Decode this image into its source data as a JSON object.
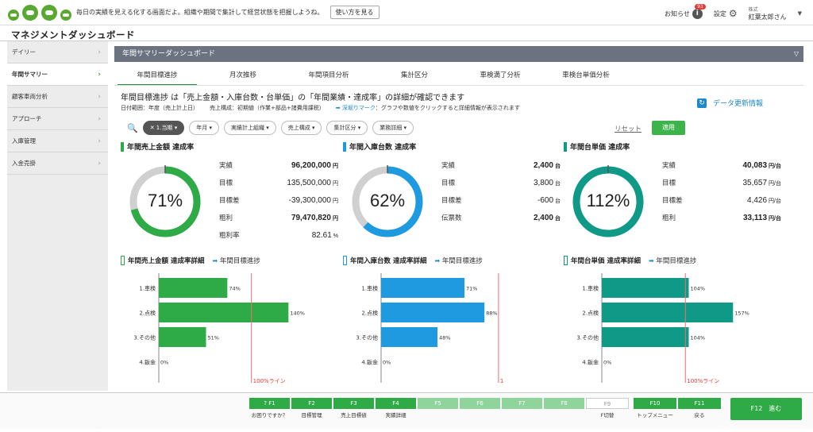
{
  "topbar": {
    "tagline": "毎日の実績を見える化する画面だよ。組織や期間で集計して経営状態を把握しようね。",
    "howto_label": "使い方を見る",
    "notice_label": "お知らせ",
    "notice_count": "93",
    "settings_label": "設定",
    "user_company": "株式",
    "user_name": "紅葉太郎さん"
  },
  "page_title": "マネジメントダッシュボード",
  "sidebar": {
    "items": [
      {
        "label": "デイリー"
      },
      {
        "label": "年間サマリー"
      },
      {
        "label": "顧客車両分析"
      },
      {
        "label": "アプローチ"
      },
      {
        "label": "入庫管理"
      },
      {
        "label": "入金売掛"
      }
    ]
  },
  "panel": {
    "title": "年間サマリーダッシュボード"
  },
  "tabs": [
    "年間目標進捗",
    "月次推移",
    "年間項目分析",
    "集計区分",
    "車検満了分析",
    "車検台単価分析"
  ],
  "summary": {
    "headline": "年間目標進捗 は「売上金額・入庫台数・台単価」の「年間業績・達成率」の詳細が確認できます",
    "date_range": "日付範囲：年度（売上計上日）",
    "sales_config": "売上構成：初期値（作業+部品+諸費用課税）",
    "drill_mark": "➡ 深堀りマーク",
    "drill_desc": "：グラフや数値をクリックすると詳細情報が表示されます",
    "refresh_label": "データ更新情報"
  },
  "filters": {
    "chips": [
      "✕ 1.当期",
      "年月",
      "実績計上組織",
      "売上構成",
      "集計区分",
      "業務詳細"
    ],
    "reset_label": "リセット",
    "apply_label": "適用"
  },
  "kpis": [
    {
      "title": "年間売上金額 達成率",
      "pct": "71%",
      "pct_value": 0.71,
      "color": "#2eaa46",
      "rows": [
        {
          "label": "実績",
          "value": "96,200,000",
          "unit": "円",
          "bold": true
        },
        {
          "label": "目標",
          "value": "135,500,000",
          "unit": "円"
        },
        {
          "label": "目標差",
          "value": "-39,300,000",
          "unit": "円"
        },
        {
          "label": "粗利",
          "value": "79,470,820",
          "unit": "円",
          "bold": true
        },
        {
          "label": "粗利率",
          "value": "82.61",
          "unit": "%"
        }
      ]
    },
    {
      "title": "年間入庫台数 達成率",
      "pct": "62%",
      "pct_value": 0.62,
      "color": "#1e9ae0",
      "rows": [
        {
          "label": "実績",
          "value": "2,400",
          "unit": "台",
          "bold": true
        },
        {
          "label": "目標",
          "value": "3,800",
          "unit": "台"
        },
        {
          "label": "目標差",
          "value": "-600",
          "unit": "台"
        },
        {
          "label": "伝票数",
          "value": "2,400",
          "unit": "台",
          "bold": true
        }
      ]
    },
    {
      "title": "年間台単価 達成率",
      "pct": "112%",
      "pct_value": 1.12,
      "color": "#0e9a86",
      "rows": [
        {
          "label": "実績",
          "value": "40,083",
          "unit": "円/台",
          "bold": true
        },
        {
          "label": "目標",
          "value": "35,657",
          "unit": "円/台"
        },
        {
          "label": "目標差",
          "value": "4,426",
          "unit": "円/台"
        },
        {
          "label": "粗利",
          "value": "33,113",
          "unit": "円/台",
          "bold": true
        }
      ]
    }
  ],
  "chart_data": [
    {
      "type": "bar",
      "title": "年間売上金額 達成率詳細",
      "link": "年間目標進捗",
      "categories": [
        "1.車検",
        "2.点検",
        "3.その他",
        "4.鈑金"
      ],
      "values": [
        74,
        140,
        51,
        0
      ],
      "value_labels": [
        "74%",
        "140%",
        "51%",
        "0%"
      ],
      "reference_line": 100,
      "reference_label": "100%ライン",
      "color": "#2eaa46"
    },
    {
      "type": "bar",
      "title": "年間入庫台数 達成率詳細",
      "link": "年間目標進捗",
      "categories": [
        "1.車検",
        "2.点検",
        "3.その他",
        "4.鈑金"
      ],
      "values": [
        71,
        88,
        48,
        0
      ],
      "value_labels": [
        "71%",
        "88%",
        "48%",
        "0%"
      ],
      "reference_line": 100,
      "reference_label": "1",
      "color": "#1e9ae0"
    },
    {
      "type": "bar",
      "title": "年間台単価 達成率詳細",
      "link": "年間目標進捗",
      "categories": [
        "1.車検",
        "2.点検",
        "3.その他",
        "4.鈑金"
      ],
      "values": [
        104,
        157,
        104,
        0
      ],
      "value_labels": [
        "104%",
        "157%",
        "104%",
        "0%"
      ],
      "reference_line": 100,
      "reference_label": "100%ライン",
      "color": "#0e9a86"
    }
  ],
  "footer": {
    "keys": [
      {
        "label": "F1",
        "sub": "お困りですか？",
        "state": "on"
      },
      {
        "label": "F2",
        "sub": "目標管理",
        "state": "on"
      },
      {
        "label": "F3",
        "sub": "売上目標値",
        "state": "on"
      },
      {
        "label": "F4",
        "sub": "実績詳細",
        "state": "on"
      },
      {
        "label": "F5",
        "sub": "",
        "state": "dim"
      },
      {
        "label": "F6",
        "sub": "",
        "state": "dim"
      },
      {
        "label": "F7",
        "sub": "",
        "state": "dim"
      },
      {
        "label": "F8",
        "sub": "",
        "state": "dim"
      },
      {
        "label": "F9",
        "sub": "F切替",
        "state": "blank"
      },
      {
        "label": "F10",
        "sub": "トップメニュー",
        "state": "on"
      },
      {
        "label": "F11",
        "sub": "戻る",
        "state": "on"
      }
    ],
    "f12_label": "F12　進む"
  }
}
